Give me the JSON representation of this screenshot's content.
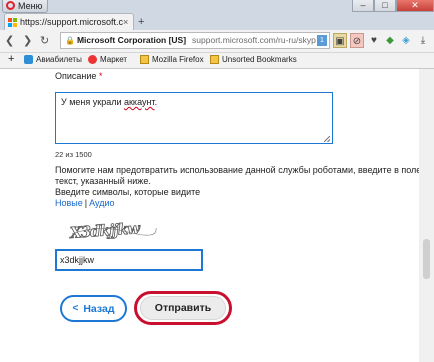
{
  "window": {
    "menu_label": "Меню",
    "controls": {
      "minimize": "–",
      "maximize": "□",
      "close": "✕"
    }
  },
  "tab": {
    "title": "https://support.microsoft.com",
    "close": "×",
    "new_tab": "+"
  },
  "address_bar": {
    "org": "Microsoft Corporation [US]",
    "path": "support.microsoft.com/ru-ru/skyp",
    "badge": "1"
  },
  "bookmarks": {
    "add": "+",
    "items": [
      {
        "label": "Авиабилеты"
      },
      {
        "label": "Маркет"
      },
      {
        "label": "Mozilla Firefox"
      },
      {
        "label": "Unsorted Bookmarks"
      }
    ]
  },
  "form": {
    "description_label": "Описание",
    "required_mark": "*",
    "description_value_pre": "У меня украли ",
    "description_value_word": "аккаунт",
    "description_value_post": ".",
    "counter": "22  из 1500",
    "help_line1": "Помогите нам предотвратить использование данной службы роботами, введите в поле",
    "help_line2": "текст, указанный ниже.",
    "help_line3": "Введите символы, которые видите",
    "link_new": "Новые",
    "link_separator": "|",
    "link_audio": "Аудио",
    "captcha_text": "X3dkjjkw",
    "captcha_value": "x3dkjjkw",
    "back_label": "Назад",
    "back_chevron": "<",
    "send_label": "Отправить"
  },
  "colors": {
    "accent": "#1c78d4",
    "highlight_ring": "#c8102e",
    "required": "#d0021b"
  }
}
